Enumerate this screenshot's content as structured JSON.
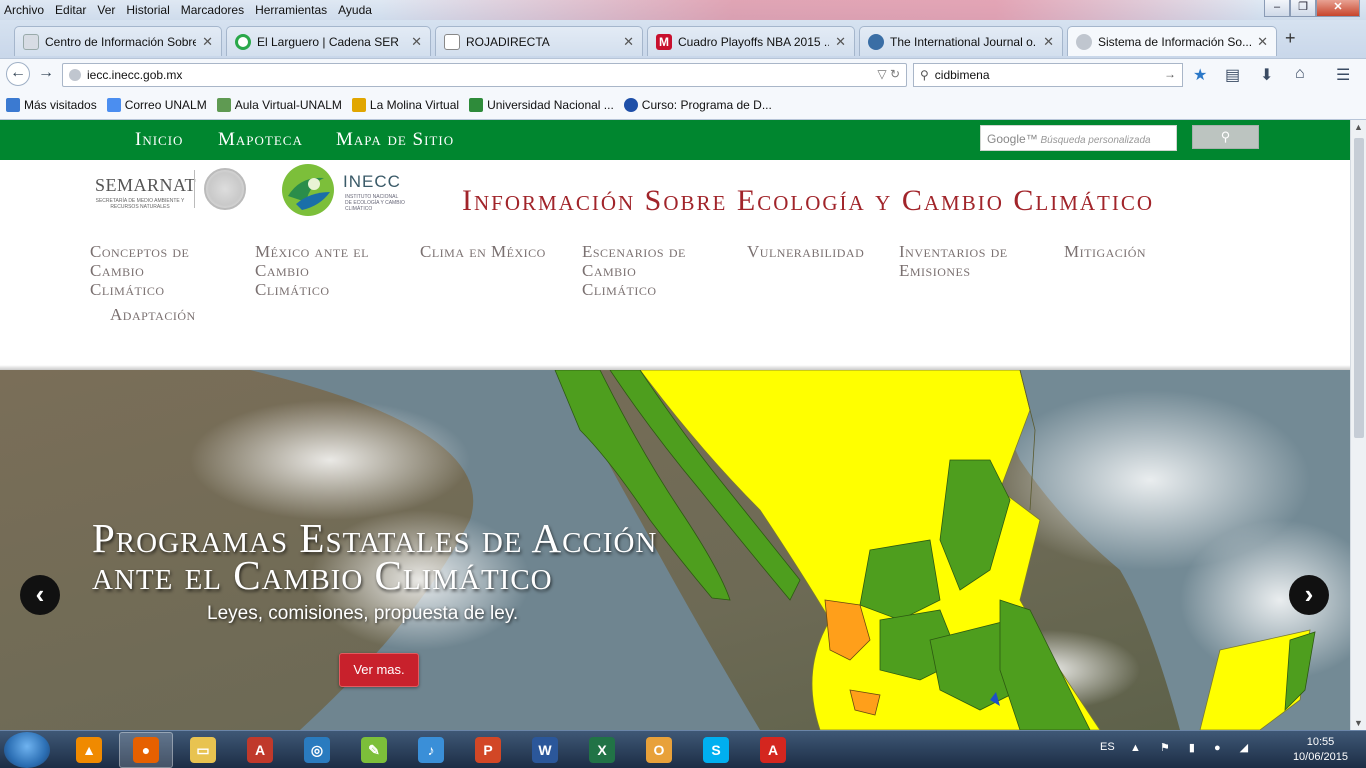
{
  "menubar": {
    "items": [
      "Archivo",
      "Editar",
      "Ver",
      "Historial",
      "Marcadores",
      "Herramientas",
      "Ayuda"
    ]
  },
  "tabs": [
    {
      "label": "Centro de Información Sobre D...",
      "icon": "document-icon",
      "color": "#d7dce4"
    },
    {
      "label": "El Larguero | Cadena SER",
      "icon": "cadena-ser-icon",
      "color": "#2aa84a"
    },
    {
      "label": "ROJADIRECTA",
      "icon": "rojadirecta-icon",
      "color": "#ffffff"
    },
    {
      "label": "Cuadro Playoffs NBA 2015 ...",
      "icon": "marca-icon",
      "color": "#c8102e"
    },
    {
      "label": "The International Journal o...",
      "icon": "journal-icon",
      "color": "#3a6ea5"
    },
    {
      "label": "Sistema de Información So...",
      "icon": "globe-icon",
      "color": "#c0c6cf"
    }
  ],
  "navbar": {
    "url": "iecc.inecc.gob.mx",
    "search_value": "cidbimena"
  },
  "bookmarks": [
    {
      "label": "Más visitados",
      "icon": "folder-icon",
      "color": "#3b7ad1"
    },
    {
      "label": "Correo UNALM",
      "icon": "google-icon",
      "color": "#4b8ef0"
    },
    {
      "label": "Aula Virtual-UNALM",
      "icon": "unalm-icon",
      "color": "#5f9a52"
    },
    {
      "label": "La Molina Virtual",
      "icon": "molina-icon",
      "color": "#e1a600"
    },
    {
      "label": "Universidad Nacional ...",
      "icon": "university-icon",
      "color": "#2e8b3a"
    },
    {
      "label": "Curso: Programa de D...",
      "icon": "course-icon",
      "color": "#1e4fa8"
    }
  ],
  "page": {
    "topnav": [
      "Inicio",
      "Mapoteca",
      "Mapa de Sitio"
    ],
    "search_brand": "Google™",
    "search_placeholder": "Búsqueda personalizada",
    "semarnat_name": "SEMARNAT",
    "semarnat_sub": "SECRETARÍA DE MEDIO AMBIENTE Y RECURSOS NATURALES",
    "inecc_name": "INECC",
    "inecc_sub": "INSTITUTO NACIONAL DE ECOLOGÍA Y CAMBIO CLIMÁTICO",
    "site_title": "Información Sobre Ecología y Cambio Climático",
    "mainnav": [
      [
        "Conceptos de",
        "Cambio",
        "Climático"
      ],
      [
        "México ante el",
        "Cambio",
        "Climático"
      ],
      [
        "Clima en México"
      ],
      [
        "Escenarios de",
        "Cambio",
        "Climático"
      ],
      [
        "Vulnerabilidad"
      ],
      [
        "Inventarios de",
        "Emisiones"
      ],
      [
        "Mitigación"
      ],
      [
        "Adaptación"
      ]
    ],
    "hero": {
      "title_line1": "Programas Estatales de Acción",
      "title_line2": "ante el Cambio Climático",
      "subtitle": "Leyes, comisiones, propuesta de ley.",
      "button": "Ver mas."
    },
    "colors": {
      "green": "#00862f",
      "title_red": "#a1242a",
      "map_yellow": "#ffff00",
      "map_green": "#4e9e1e",
      "map_orange": "#ff9f1a"
    }
  },
  "taskbar": {
    "apps": [
      {
        "name": "vlc-icon",
        "color": "#f08a00",
        "glyph": "▲"
      },
      {
        "name": "firefox-icon",
        "color": "#e66000",
        "glyph": "●"
      },
      {
        "name": "explorer-icon",
        "color": "#e8c350",
        "glyph": "▭"
      },
      {
        "name": "autocad-icon",
        "color": "#c0392b",
        "glyph": "A"
      },
      {
        "name": "search-tool-icon",
        "color": "#2a7bbf",
        "glyph": "◎"
      },
      {
        "name": "camtasia-icon",
        "color": "#7cbf3a",
        "glyph": "✎"
      },
      {
        "name": "itunes-icon",
        "color": "#3a8fd8",
        "glyph": "♪"
      },
      {
        "name": "powerpoint-icon",
        "color": "#d24726",
        "glyph": "P"
      },
      {
        "name": "word-icon",
        "color": "#2b579a",
        "glyph": "W"
      },
      {
        "name": "excel-icon",
        "color": "#217346",
        "glyph": "X"
      },
      {
        "name": "outlook-icon",
        "color": "#e8a13a",
        "glyph": "O"
      },
      {
        "name": "skype-icon",
        "color": "#00aff0",
        "glyph": "S"
      },
      {
        "name": "acrobat-icon",
        "color": "#d4261f",
        "glyph": "A"
      }
    ],
    "lang": "ES",
    "time": "10:55",
    "date": "10/06/2015"
  }
}
